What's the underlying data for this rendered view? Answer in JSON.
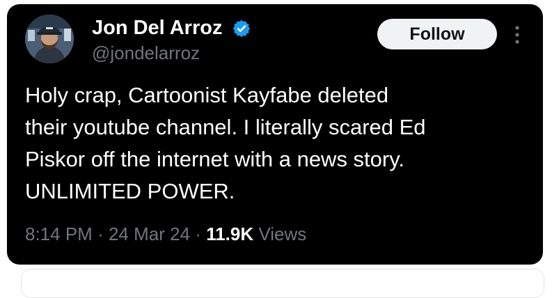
{
  "tweet": {
    "author": {
      "display_name": "Jon Del Arroz",
      "handle": "@jondelarroz",
      "verified": true
    },
    "follow_label": "Follow",
    "text": "Holy crap, Cartoonist Kayfabe deleted\ntheir youtube channel. I literally scared Ed\nPiskor off the internet with a news story.\nUNLIMITED POWER.",
    "time": "8:14 PM",
    "separator": "·",
    "date": "24 Mar 24",
    "views_count": "11.9K",
    "views_label": "Views"
  },
  "icons": {
    "verified": "verified-badge-icon",
    "more": "more-vertical-icon"
  },
  "colors": {
    "card_background": "#000000",
    "verified_blue": "#1d9bf0",
    "secondary_text": "#71767b",
    "follow_button_bg": "#eff3f4"
  }
}
